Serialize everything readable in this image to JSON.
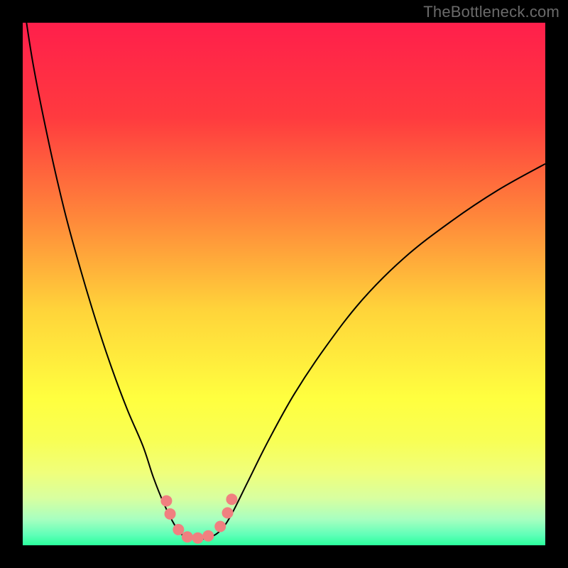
{
  "watermark": "TheBottleneck.com",
  "chart_data": {
    "type": "line",
    "title": "",
    "xlabel": "",
    "ylabel": "",
    "xlim": [
      0,
      100
    ],
    "ylim": [
      0,
      100
    ],
    "gradient_stops": [
      {
        "pos": 0.0,
        "color": "#ff1f4b"
      },
      {
        "pos": 0.18,
        "color": "#ff3a3f"
      },
      {
        "pos": 0.38,
        "color": "#ff8a3a"
      },
      {
        "pos": 0.55,
        "color": "#ffd43a"
      },
      {
        "pos": 0.72,
        "color": "#ffff3f"
      },
      {
        "pos": 0.8,
        "color": "#f8ff55"
      },
      {
        "pos": 0.86,
        "color": "#f0ff7a"
      },
      {
        "pos": 0.91,
        "color": "#d8ffa0"
      },
      {
        "pos": 0.95,
        "color": "#a8ffc0"
      },
      {
        "pos": 0.98,
        "color": "#60ffb8"
      },
      {
        "pos": 1.0,
        "color": "#2bff9d"
      }
    ],
    "series": [
      {
        "name": "curve",
        "x": [
          0,
          2,
          5,
          8,
          11,
          14,
          17,
          20,
          23,
          25,
          27,
          29,
          30.5,
          32,
          34,
          36,
          38,
          40,
          43,
          47,
          52,
          58,
          65,
          73,
          82,
          91,
          100
        ],
        "y": [
          105,
          92,
          77,
          64,
          53,
          43,
          34,
          26,
          19,
          13,
          8,
          4,
          2,
          1.3,
          1.2,
          1.6,
          3,
          6,
          12,
          20,
          29,
          38,
          47,
          55,
          62,
          68,
          73
        ]
      }
    ],
    "markers": [
      {
        "x": 27.5,
        "y": 8.5
      },
      {
        "x": 28.2,
        "y": 6.0
      },
      {
        "x": 29.8,
        "y": 3.0
      },
      {
        "x": 31.5,
        "y": 1.6
      },
      {
        "x": 33.5,
        "y": 1.4
      },
      {
        "x": 35.5,
        "y": 1.8
      },
      {
        "x": 37.8,
        "y": 3.6
      },
      {
        "x": 39.2,
        "y": 6.2
      },
      {
        "x": 40.0,
        "y": 8.8
      }
    ],
    "marker_color": "#f08080",
    "marker_radius": 8,
    "curve_color": "#000000",
    "curve_width": 2
  }
}
